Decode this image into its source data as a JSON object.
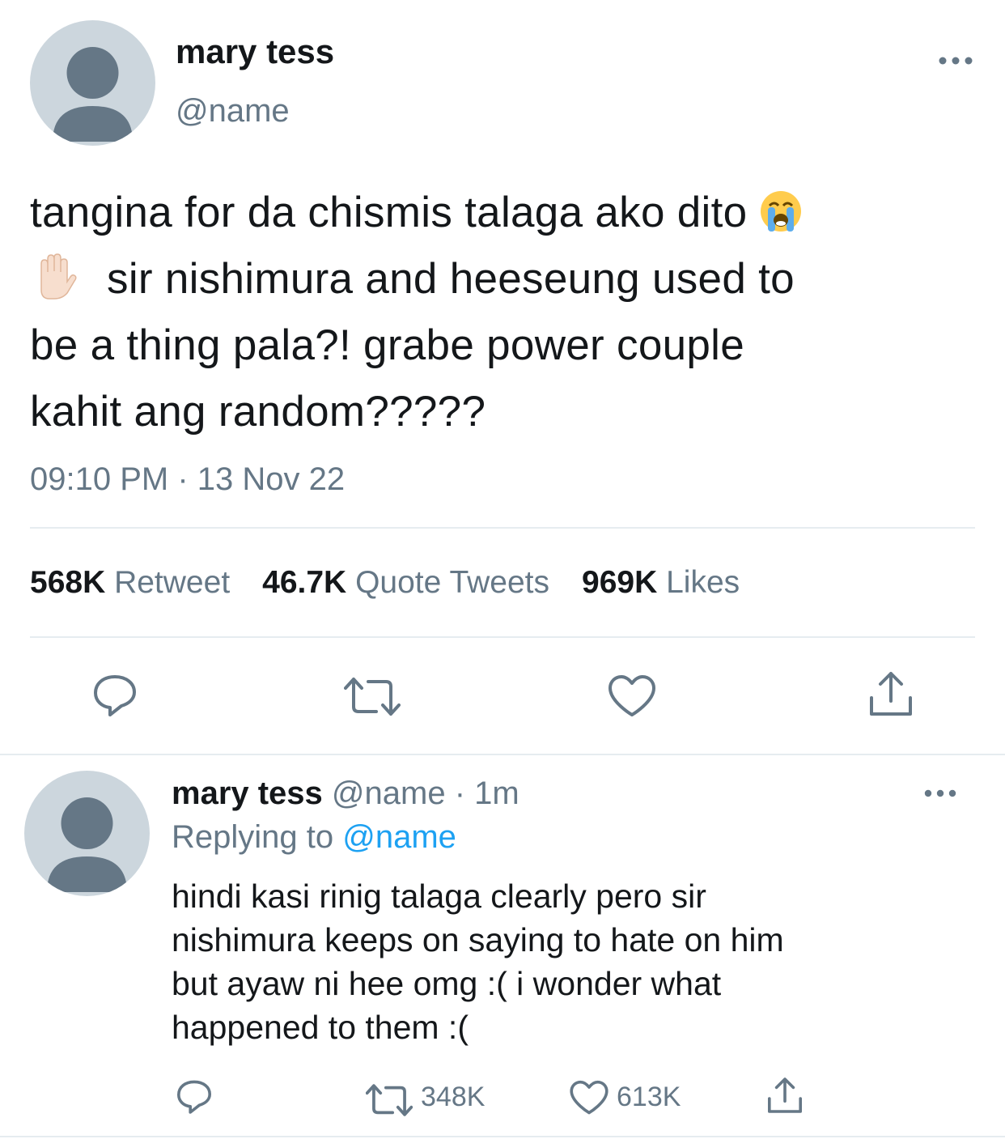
{
  "main_tweet": {
    "display_name": "mary tess",
    "handle": "@name",
    "text_line1": "tangina for da chismis talaga ako dito",
    "text_line2": "sir nishimura and heeseung used to",
    "text_line3": "be a thing pala?! grabe power couple",
    "text_line4": "kahit ang random?????",
    "emoji_1": "loudly-crying-face",
    "emoji_2": "raised-hand",
    "timestamp": "09:10 PM · 13 Nov 22",
    "stats": {
      "retweets_count": "568K",
      "retweets_label": "Retweet",
      "quotes_count": "46.7K",
      "quotes_label": "Quote Tweets",
      "likes_count": "969K",
      "likes_label": "Likes"
    },
    "actions": [
      "reply-icon",
      "retweet-icon",
      "like-icon",
      "share-icon"
    ]
  },
  "reply_tweet": {
    "display_name": "mary tess",
    "handle": "@name",
    "time_ago": "1m",
    "separator": " · ",
    "replying_prefix": "Replying to",
    "replying_to": "@name",
    "text_line1": "hindi kasi rinig talaga clearly pero sir",
    "text_line2": "nishimura keeps on saying to hate on him",
    "text_line3": "but ayaw ni hee omg :( i wonder what",
    "text_line4": "happened to them :(",
    "retweet_count": "348K",
    "like_count": "613K"
  },
  "colors": {
    "text": "#14171a",
    "secondary": "#657786",
    "link": "#1da1f2",
    "divider": "#e6ecf0",
    "avatar_bg": "#ccd6dd",
    "avatar_fg": "#657786"
  }
}
